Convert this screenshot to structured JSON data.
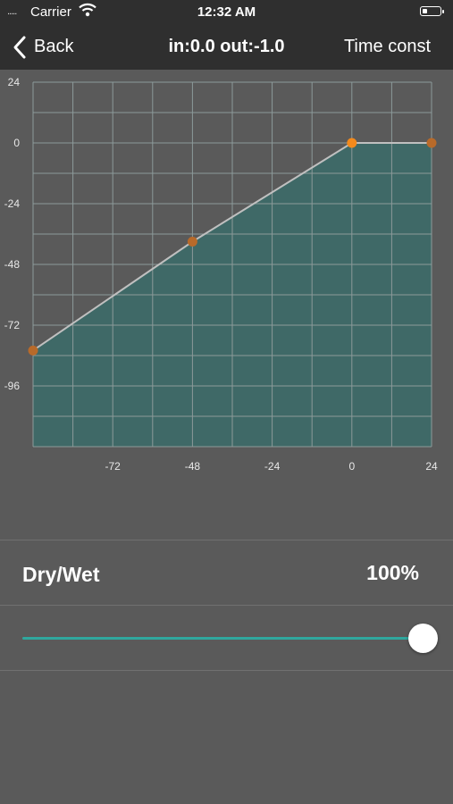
{
  "status_bar": {
    "signal": ".....",
    "carrier": "Carrier",
    "time": "12:32 AM"
  },
  "nav": {
    "back_label": "Back",
    "title": "in:0.0 out:-1.0",
    "right_button": "Time const"
  },
  "chart_data": {
    "type": "line",
    "x_range": [
      -96,
      24
    ],
    "y_range": [
      -120,
      24
    ],
    "x_ticks": [
      -72,
      -48,
      -24,
      0,
      24
    ],
    "y_ticks": [
      24,
      0,
      -24,
      -48,
      -72,
      -96
    ],
    "grid_step": 12,
    "grid": true,
    "points": [
      {
        "x": -96,
        "y": -82
      },
      {
        "x": -48,
        "y": -39
      },
      {
        "x": 0,
        "y": 0
      },
      {
        "x": 24,
        "y": 0
      }
    ],
    "active_point_index": 2,
    "fill_color": "#3f6967",
    "line_color": "#c0c0c0",
    "point_color": "#b86a2a",
    "active_point_color": "#f38a1c",
    "grid_color": "#8c9a9a"
  },
  "drywet": {
    "label": "Dry/Wet",
    "value_text": "100%",
    "fraction": 1.0
  },
  "colors": {
    "accent": "#2fa79e",
    "bar_background": "#2f2f2f",
    "background": "#5a5a5a"
  }
}
